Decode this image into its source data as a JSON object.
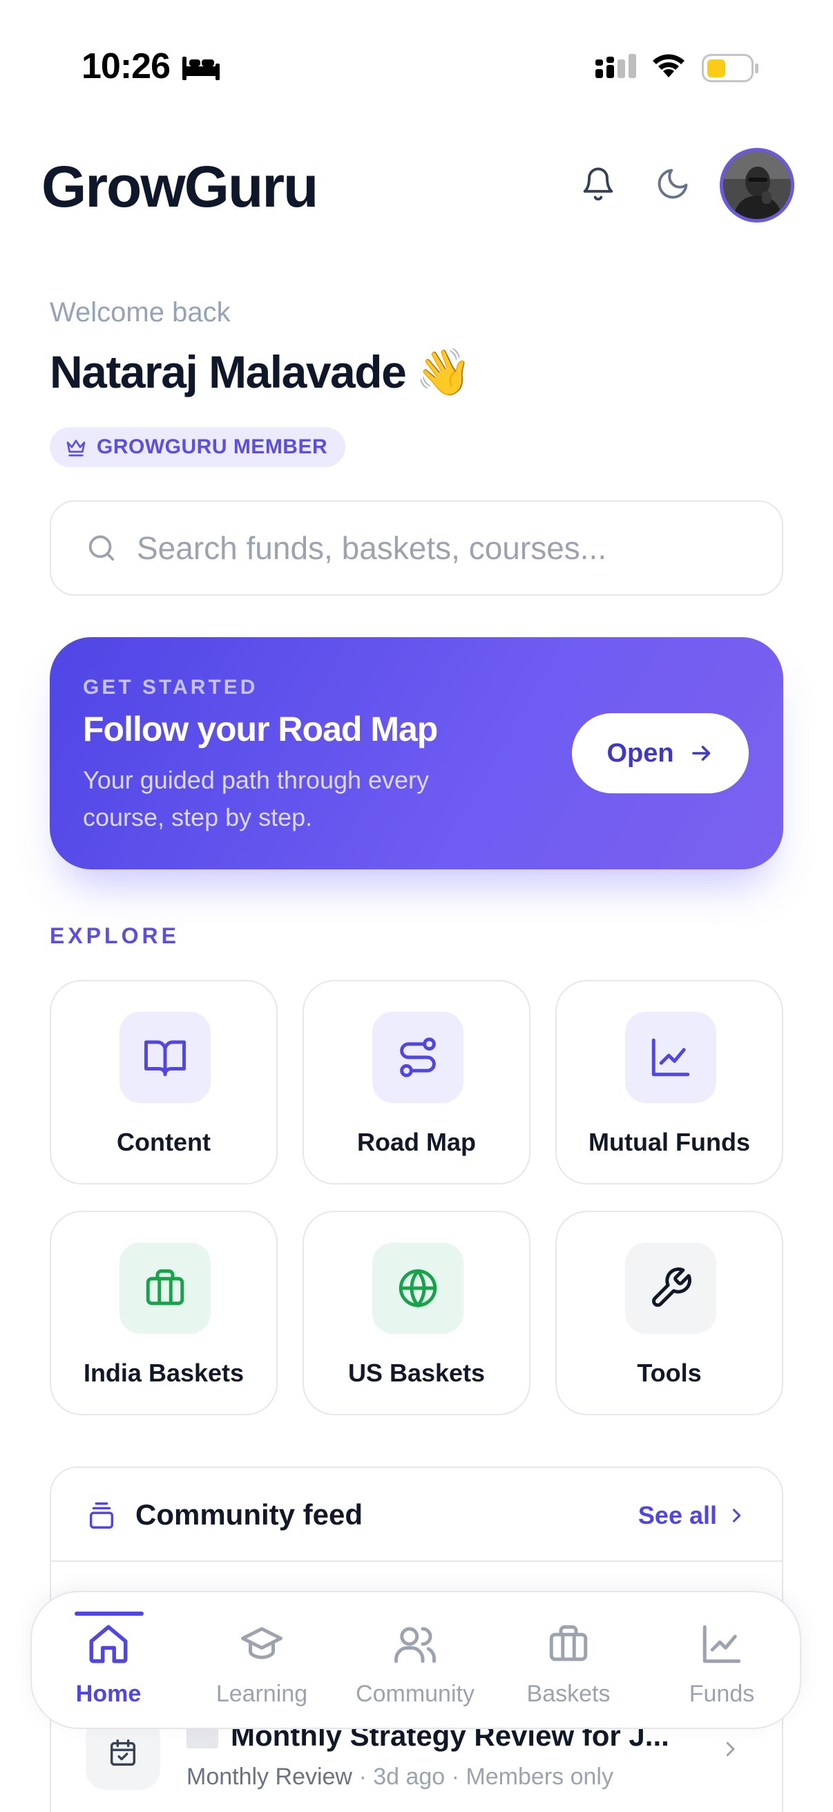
{
  "status_bar": {
    "time": "10:26",
    "battery_color": "#facc15"
  },
  "header": {
    "brand": "GrowGuru"
  },
  "welcome": {
    "greeting": "Welcome back",
    "name": "Nataraj Malavade",
    "wave_emoji": "👋",
    "badge": "GROWGURU MEMBER"
  },
  "search": {
    "placeholder": "Search funds, baskets, courses..."
  },
  "promo": {
    "kicker": "GET STARTED",
    "title": "Follow your Road Map",
    "description": "Your guided path through every course, step by step.",
    "button_label": "Open"
  },
  "explore": {
    "label": "EXPLORE",
    "tiles": [
      {
        "label": "Content",
        "icon": "book-icon"
      },
      {
        "label": "Road Map",
        "icon": "route-icon"
      },
      {
        "label": "Mutual Funds",
        "icon": "line-chart-icon"
      },
      {
        "label": "India Baskets",
        "icon": "briefcase-icon"
      },
      {
        "label": "US Baskets",
        "icon": "globe-icon"
      },
      {
        "label": "Tools",
        "icon": "wrench-icon"
      }
    ]
  },
  "community": {
    "title": "Community feed",
    "see_all": "See all",
    "item": {
      "title": "Monthly Strategy Review for J...",
      "category": "Monthly Review",
      "time": "3d ago",
      "visibility": "Members only"
    }
  },
  "bottom_nav": {
    "items": [
      {
        "label": "Home",
        "active": true
      },
      {
        "label": "Learning",
        "active": false
      },
      {
        "label": "Community",
        "active": false
      },
      {
        "label": "Baskets",
        "active": false
      },
      {
        "label": "Funds",
        "active": false
      }
    ]
  },
  "colors": {
    "accent": "#4f46e5",
    "accent_light": "#eeedfd",
    "green": "#16a34a",
    "text": "#0f172a",
    "muted": "#9ca3af"
  }
}
